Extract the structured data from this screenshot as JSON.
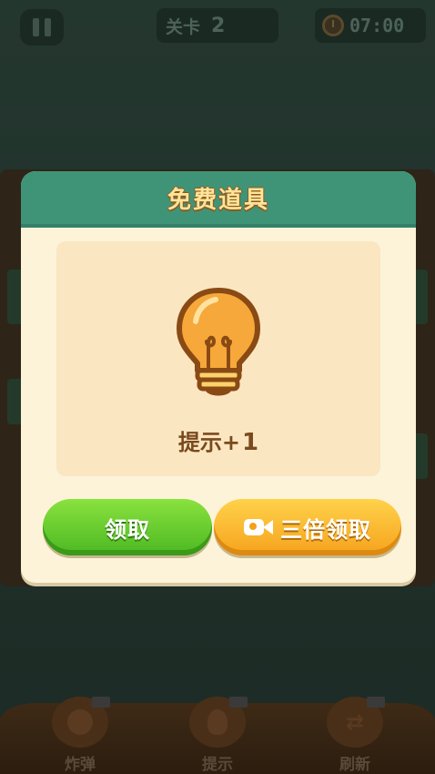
{
  "topbar": {
    "level_label": "关卡",
    "level_value": "2",
    "timer": "07:00"
  },
  "tools": [
    {
      "label": "炸弹",
      "icon": "bomb-icon"
    },
    {
      "label": "提示",
      "icon": "lightbulb-icon"
    },
    {
      "label": "刷新",
      "icon": "shuffle-icon"
    }
  ],
  "modal": {
    "title": "免费道具",
    "reward_icon": "lightbulb-icon",
    "reward_label": "提示+",
    "reward_count": "1",
    "claim_label": "领取",
    "triple_claim_label": "三倍领取"
  },
  "colors": {
    "header": "#3f9478",
    "modal_bg": "#fdf3d9",
    "claim_green": "#5cc42a",
    "triple_orange": "#f6a21d",
    "title_text": "#ffe49a"
  }
}
